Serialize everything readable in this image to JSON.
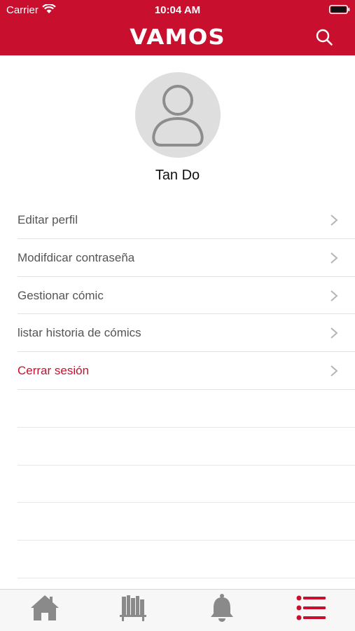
{
  "status_bar": {
    "carrier": "Carrier",
    "time": "10:04 AM"
  },
  "header": {
    "title": "VAMOS",
    "accent_color": "#c8102e"
  },
  "profile": {
    "name": "Tan Do"
  },
  "menu": {
    "items": [
      {
        "label": "Editar perfil"
      },
      {
        "label": "Modifdicar contraseña"
      },
      {
        "label": "Gestionar cómic"
      },
      {
        "label": "listar historia de cómics"
      },
      {
        "label": "Cerrar sesión"
      }
    ]
  },
  "tab_bar": {
    "tabs": [
      {
        "icon": "home-icon",
        "active": false
      },
      {
        "icon": "library-icon",
        "active": false
      },
      {
        "icon": "bell-icon",
        "active": false
      },
      {
        "icon": "menu-list-icon",
        "active": true
      }
    ]
  }
}
